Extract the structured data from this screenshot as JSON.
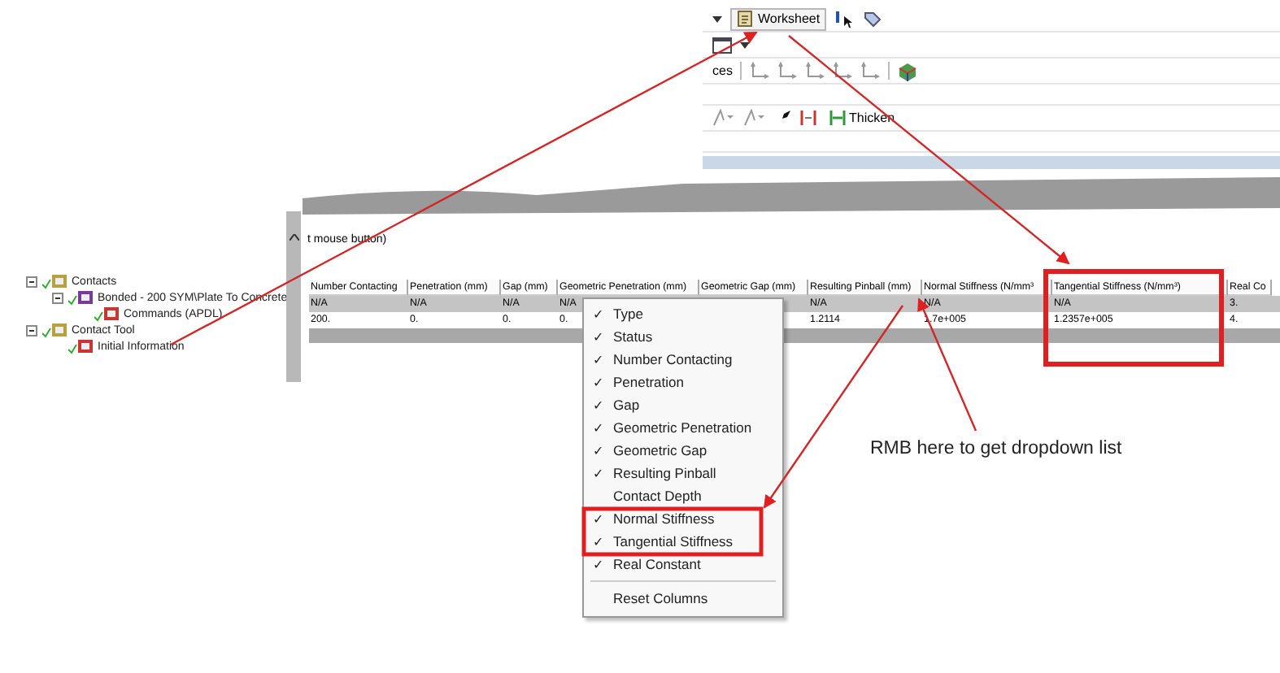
{
  "toolbar": {
    "worksheet_button": "Worksheet",
    "partial_label": "ces",
    "thicken_button": "Thicken"
  },
  "tree": [
    {
      "label": "Contacts",
      "expanded": true,
      "children": [
        {
          "label": "Bonded - 200 SYM\\Plate To Concrete",
          "expanded": true,
          "children": [
            {
              "label": "Commands (APDL)"
            }
          ]
        }
      ]
    },
    {
      "label": "Contact Tool",
      "expanded": true,
      "children": [
        {
          "label": "Initial Information"
        }
      ]
    }
  ],
  "worksheet_hint": "t mouse button)",
  "table": {
    "columns": [
      "Number Contacting",
      "Penetration (mm)",
      "Gap (mm)",
      "Geometric Penetration (mm)",
      "Geometric Gap (mm)",
      "Resulting Pinball (mm)",
      "Normal Stiffness (N/mm³",
      "Tangential Stiffness (N/mm³)",
      "Real Co"
    ],
    "rows": [
      {
        "selected": true,
        "cells": [
          "N/A",
          "N/A",
          "N/A",
          "N/A",
          "",
          "N/A",
          "N/A",
          "N/A",
          "3."
        ]
      },
      {
        "selected": false,
        "cells": [
          "200.",
          "0.",
          "0.",
          "0.",
          "",
          "1.2114",
          "1.7e+005",
          "1.2357e+005",
          "4."
        ]
      }
    ]
  },
  "context_menu": {
    "items": [
      {
        "label": "Type",
        "checked": true
      },
      {
        "label": "Status",
        "checked": true
      },
      {
        "label": "Number Contacting",
        "checked": true
      },
      {
        "label": "Penetration",
        "checked": true
      },
      {
        "label": "Gap",
        "checked": true
      },
      {
        "label": "Geometric Penetration",
        "checked": true
      },
      {
        "label": "Geometric Gap",
        "checked": true
      },
      {
        "label": "Resulting Pinball",
        "checked": true
      },
      {
        "label": "Contact Depth",
        "checked": false
      },
      {
        "label": "Normal Stiffness",
        "checked": true
      },
      {
        "label": "Tangential Stiffness",
        "checked": true
      },
      {
        "label": "Real Constant",
        "checked": true
      }
    ],
    "reset": "Reset Columns",
    "check_glyph": "✓"
  },
  "annotation": "RMB here to get dropdown list"
}
